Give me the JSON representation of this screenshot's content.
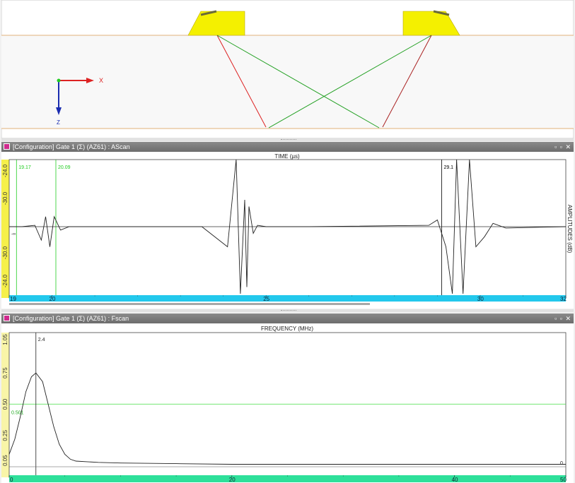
{
  "top_view": {
    "x_axis_label": "X",
    "z_axis_label": "Z"
  },
  "ascan": {
    "title": "[Configuration] Gate 1 (Σ) (AZ61) : AScan",
    "window_controls": "▫ ▫ ✕",
    "x_axis_title": "TIME (µs)",
    "right_axis_title": "AMPLITUDES (dB)",
    "cursors": [
      {
        "label": "19.17",
        "value": 19.17,
        "color": "#22cc22"
      },
      {
        "label": "20.09",
        "value": 20.09,
        "color": "#22cc22"
      },
      {
        "label": "29.1",
        "value": 29.1,
        "color": "#000000"
      }
    ],
    "x_ticks": [
      "19",
      "20",
      "25",
      "30",
      "32"
    ],
    "y_ticks": [
      "-24.0",
      "-30.0",
      "-30.0",
      "-24.0"
    ],
    "left_marker": "-∞",
    "xlim": [
      19,
      32
    ]
  },
  "fscan": {
    "title": "[Configuration] Gate 1 (Σ) (AZ61) : Fscan",
    "window_controls": "▫ ▫ ✕",
    "x_axis_title": "FREQUENCY (MHz)",
    "cursor_label": "2.4",
    "cursor_value": 2.4,
    "threshold_label": "0.501",
    "threshold_value": 0.501,
    "right_end_label": "0",
    "x_ticks": [
      "0",
      "20",
      "40",
      "50"
    ],
    "y_ticks": [
      "1.05",
      "0.75",
      "0.50",
      "0.25",
      "0.05"
    ],
    "xlim": [
      0,
      50
    ],
    "ylim": [
      0,
      1.05
    ]
  },
  "chart_data": [
    {
      "type": "line",
      "title": "",
      "xlabel": "TIME (µs)",
      "ylabel": "AMPLITUDES (dB)",
      "xlim": [
        19,
        32
      ],
      "series": [
        {
          "x": [
            19,
            19.3,
            19.6,
            19.75,
            19.85,
            19.95,
            20.05,
            20.2,
            20.4,
            21,
            23.5,
            24.1,
            24.3,
            24.4,
            24.5,
            24.55,
            24.6,
            24.7,
            24.8,
            25.0,
            25.3,
            26,
            28.8,
            29.0,
            29.2,
            29.35,
            29.45,
            29.6,
            29.75,
            29.9,
            30.1,
            30.3,
            30.6,
            32
          ],
          "y": [
            0,
            0,
            0.02,
            -0.2,
            0.15,
            -0.3,
            0.15,
            -0.05,
            0,
            0,
            0,
            -0.3,
            1.0,
            -1.0,
            0.4,
            -0.9,
            0.3,
            -0.1,
            0.02,
            0,
            0,
            0,
            0.02,
            0.1,
            -0.3,
            -1.0,
            1.0,
            -1.0,
            1.0,
            -0.3,
            -0.15,
            0.05,
            -0.02,
            0
          ]
        }
      ]
    },
    {
      "type": "line",
      "title": "",
      "xlabel": "FREQUENCY (MHz)",
      "ylabel": "",
      "xlim": [
        0,
        50
      ],
      "ylim": [
        0,
        1.05
      ],
      "grid": false,
      "series": [
        {
          "x": [
            0,
            0.5,
            1,
            1.5,
            2,
            2.4,
            3,
            3.5,
            4,
            4.5,
            5,
            5.5,
            6,
            7,
            8,
            10,
            15,
            20,
            30,
            40,
            50
          ],
          "y": [
            0.1,
            0.22,
            0.4,
            0.6,
            0.72,
            0.75,
            0.68,
            0.5,
            0.32,
            0.18,
            0.1,
            0.06,
            0.045,
            0.04,
            0.035,
            0.03,
            0.025,
            0.02,
            0.02,
            0.02,
            0.02
          ]
        }
      ]
    }
  ]
}
